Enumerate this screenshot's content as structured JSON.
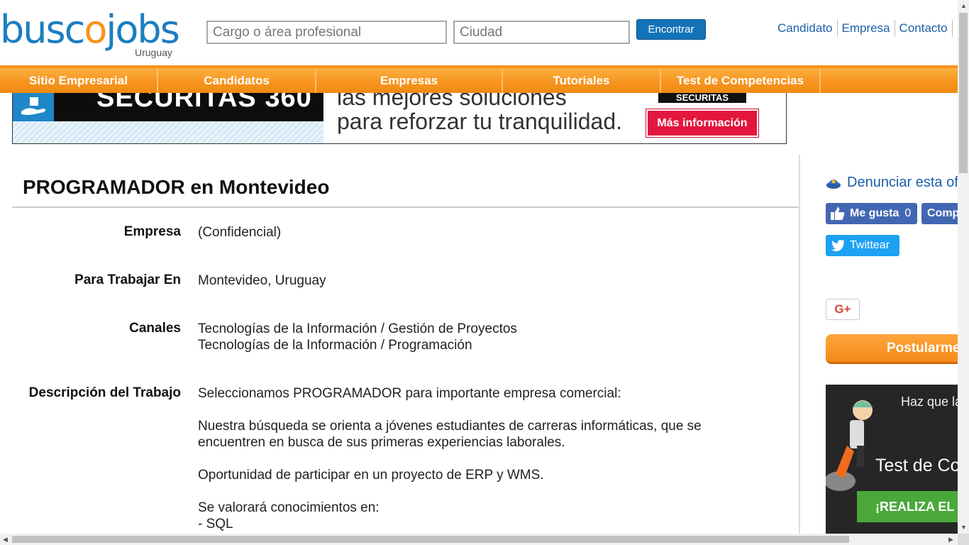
{
  "logo": {
    "busc": "busc",
    "o": "o",
    "jobs": "jobs",
    "country": "Uruguay"
  },
  "search": {
    "cargo_placeholder": "Cargo o área profesional",
    "ciudad_placeholder": "Ciudad",
    "button_label": "Encontrar"
  },
  "top_links": [
    "Candidato",
    "Empresa",
    "Contacto"
  ],
  "nav": {
    "items": [
      "Sitio Empresarial",
      "Candidatos",
      "Empresas",
      "Tutoriales",
      "Test de Competencias"
    ]
  },
  "banner": {
    "brand": "SECURITAS 360",
    "line1": "las mejores soluciones",
    "line2": "para reforzar tu tranquilidad.",
    "logo": "SECURITAS",
    "cta": "Más información"
  },
  "job": {
    "title": "PROGRAMADOR en Montevideo",
    "fields": {
      "empresa_label": "Empresa",
      "empresa_value": "(Confidencial)",
      "lugar_label": "Para Trabajar En",
      "lugar_value": "Montevideo, Uruguay",
      "canales_label": "Canales",
      "canales_values": [
        "Tecnologías de la Información / Gestión de Proyectos",
        "Tecnologías de la Información / Programación"
      ],
      "descripcion_label": "Descripción del Trabajo",
      "descripcion_lines": [
        "Seleccionamos PROGRAMADOR para importante empresa comercial:",
        "",
        "Nuestra búsqueda se orienta a jóvenes estudiantes de carreras informáticas, que se",
        "encuentren en busca de sus primeras experiencias laborales.",
        "",
        "Oportunidad de participar en un proyecto de ERP y WMS.",
        "",
        "Se valorará conocimientos en:",
        "- SQL"
      ]
    }
  },
  "sidebar": {
    "report_label": "Denunciar esta ofe",
    "fb_like_label": "Me gusta",
    "fb_like_count": "0",
    "fb_share_label": "Comp",
    "tweet_label": "Twittear",
    "gplus_label": "G+",
    "apply_label": "Postularme",
    "promo_text1": "Haz que la",
    "promo_text2": "Test de Com",
    "promo_cta": "¡REALIZA EL T"
  },
  "colors": {
    "brand_blue": "#1c7ec0",
    "brand_orange": "#f7941d",
    "link_blue": "#1c5fa8",
    "facebook": "#4267b2",
    "twitter": "#1da1f2"
  }
}
